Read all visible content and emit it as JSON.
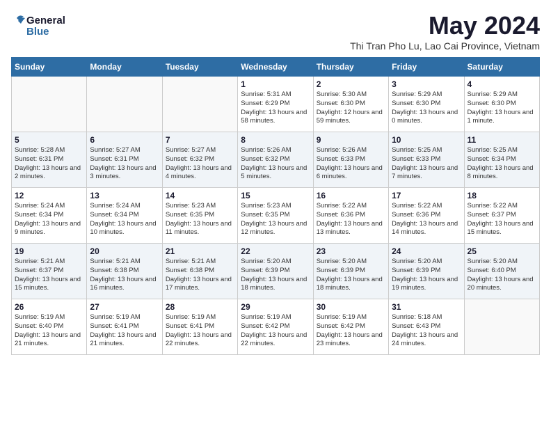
{
  "header": {
    "logo_general": "General",
    "logo_blue": "Blue",
    "month_year": "May 2024",
    "location": "Thi Tran Pho Lu, Lao Cai Province, Vietnam"
  },
  "weekdays": [
    "Sunday",
    "Monday",
    "Tuesday",
    "Wednesday",
    "Thursday",
    "Friday",
    "Saturday"
  ],
  "weeks": [
    [
      {
        "day": "",
        "sunrise": "",
        "sunset": "",
        "daylight": ""
      },
      {
        "day": "",
        "sunrise": "",
        "sunset": "",
        "daylight": ""
      },
      {
        "day": "",
        "sunrise": "",
        "sunset": "",
        "daylight": ""
      },
      {
        "day": "1",
        "sunrise": "Sunrise: 5:31 AM",
        "sunset": "Sunset: 6:29 PM",
        "daylight": "Daylight: 13 hours and 58 minutes."
      },
      {
        "day": "2",
        "sunrise": "Sunrise: 5:30 AM",
        "sunset": "Sunset: 6:30 PM",
        "daylight": "Daylight: 12 hours and 59 minutes."
      },
      {
        "day": "3",
        "sunrise": "Sunrise: 5:29 AM",
        "sunset": "Sunset: 6:30 PM",
        "daylight": "Daylight: 13 hours and 0 minutes."
      },
      {
        "day": "4",
        "sunrise": "Sunrise: 5:29 AM",
        "sunset": "Sunset: 6:30 PM",
        "daylight": "Daylight: 13 hours and 1 minute."
      }
    ],
    [
      {
        "day": "5",
        "sunrise": "Sunrise: 5:28 AM",
        "sunset": "Sunset: 6:31 PM",
        "daylight": "Daylight: 13 hours and 2 minutes."
      },
      {
        "day": "6",
        "sunrise": "Sunrise: 5:27 AM",
        "sunset": "Sunset: 6:31 PM",
        "daylight": "Daylight: 13 hours and 3 minutes."
      },
      {
        "day": "7",
        "sunrise": "Sunrise: 5:27 AM",
        "sunset": "Sunset: 6:32 PM",
        "daylight": "Daylight: 13 hours and 4 minutes."
      },
      {
        "day": "8",
        "sunrise": "Sunrise: 5:26 AM",
        "sunset": "Sunset: 6:32 PM",
        "daylight": "Daylight: 13 hours and 5 minutes."
      },
      {
        "day": "9",
        "sunrise": "Sunrise: 5:26 AM",
        "sunset": "Sunset: 6:33 PM",
        "daylight": "Daylight: 13 hours and 6 minutes."
      },
      {
        "day": "10",
        "sunrise": "Sunrise: 5:25 AM",
        "sunset": "Sunset: 6:33 PM",
        "daylight": "Daylight: 13 hours and 7 minutes."
      },
      {
        "day": "11",
        "sunrise": "Sunrise: 5:25 AM",
        "sunset": "Sunset: 6:34 PM",
        "daylight": "Daylight: 13 hours and 8 minutes."
      }
    ],
    [
      {
        "day": "12",
        "sunrise": "Sunrise: 5:24 AM",
        "sunset": "Sunset: 6:34 PM",
        "daylight": "Daylight: 13 hours and 9 minutes."
      },
      {
        "day": "13",
        "sunrise": "Sunrise: 5:24 AM",
        "sunset": "Sunset: 6:34 PM",
        "daylight": "Daylight: 13 hours and 10 minutes."
      },
      {
        "day": "14",
        "sunrise": "Sunrise: 5:23 AM",
        "sunset": "Sunset: 6:35 PM",
        "daylight": "Daylight: 13 hours and 11 minutes."
      },
      {
        "day": "15",
        "sunrise": "Sunrise: 5:23 AM",
        "sunset": "Sunset: 6:35 PM",
        "daylight": "Daylight: 13 hours and 12 minutes."
      },
      {
        "day": "16",
        "sunrise": "Sunrise: 5:22 AM",
        "sunset": "Sunset: 6:36 PM",
        "daylight": "Daylight: 13 hours and 13 minutes."
      },
      {
        "day": "17",
        "sunrise": "Sunrise: 5:22 AM",
        "sunset": "Sunset: 6:36 PM",
        "daylight": "Daylight: 13 hours and 14 minutes."
      },
      {
        "day": "18",
        "sunrise": "Sunrise: 5:22 AM",
        "sunset": "Sunset: 6:37 PM",
        "daylight": "Daylight: 13 hours and 15 minutes."
      }
    ],
    [
      {
        "day": "19",
        "sunrise": "Sunrise: 5:21 AM",
        "sunset": "Sunset: 6:37 PM",
        "daylight": "Daylight: 13 hours and 15 minutes."
      },
      {
        "day": "20",
        "sunrise": "Sunrise: 5:21 AM",
        "sunset": "Sunset: 6:38 PM",
        "daylight": "Daylight: 13 hours and 16 minutes."
      },
      {
        "day": "21",
        "sunrise": "Sunrise: 5:21 AM",
        "sunset": "Sunset: 6:38 PM",
        "daylight": "Daylight: 13 hours and 17 minutes."
      },
      {
        "day": "22",
        "sunrise": "Sunrise: 5:20 AM",
        "sunset": "Sunset: 6:39 PM",
        "daylight": "Daylight: 13 hours and 18 minutes."
      },
      {
        "day": "23",
        "sunrise": "Sunrise: 5:20 AM",
        "sunset": "Sunset: 6:39 PM",
        "daylight": "Daylight: 13 hours and 18 minutes."
      },
      {
        "day": "24",
        "sunrise": "Sunrise: 5:20 AM",
        "sunset": "Sunset: 6:39 PM",
        "daylight": "Daylight: 13 hours and 19 minutes."
      },
      {
        "day": "25",
        "sunrise": "Sunrise: 5:20 AM",
        "sunset": "Sunset: 6:40 PM",
        "daylight": "Daylight: 13 hours and 20 minutes."
      }
    ],
    [
      {
        "day": "26",
        "sunrise": "Sunrise: 5:19 AM",
        "sunset": "Sunset: 6:40 PM",
        "daylight": "Daylight: 13 hours and 21 minutes."
      },
      {
        "day": "27",
        "sunrise": "Sunrise: 5:19 AM",
        "sunset": "Sunset: 6:41 PM",
        "daylight": "Daylight: 13 hours and 21 minutes."
      },
      {
        "day": "28",
        "sunrise": "Sunrise: 5:19 AM",
        "sunset": "Sunset: 6:41 PM",
        "daylight": "Daylight: 13 hours and 22 minutes."
      },
      {
        "day": "29",
        "sunrise": "Sunrise: 5:19 AM",
        "sunset": "Sunset: 6:42 PM",
        "daylight": "Daylight: 13 hours and 22 minutes."
      },
      {
        "day": "30",
        "sunrise": "Sunrise: 5:19 AM",
        "sunset": "Sunset: 6:42 PM",
        "daylight": "Daylight: 13 hours and 23 minutes."
      },
      {
        "day": "31",
        "sunrise": "Sunrise: 5:18 AM",
        "sunset": "Sunset: 6:43 PM",
        "daylight": "Daylight: 13 hours and 24 minutes."
      },
      {
        "day": "",
        "sunrise": "",
        "sunset": "",
        "daylight": ""
      }
    ]
  ]
}
